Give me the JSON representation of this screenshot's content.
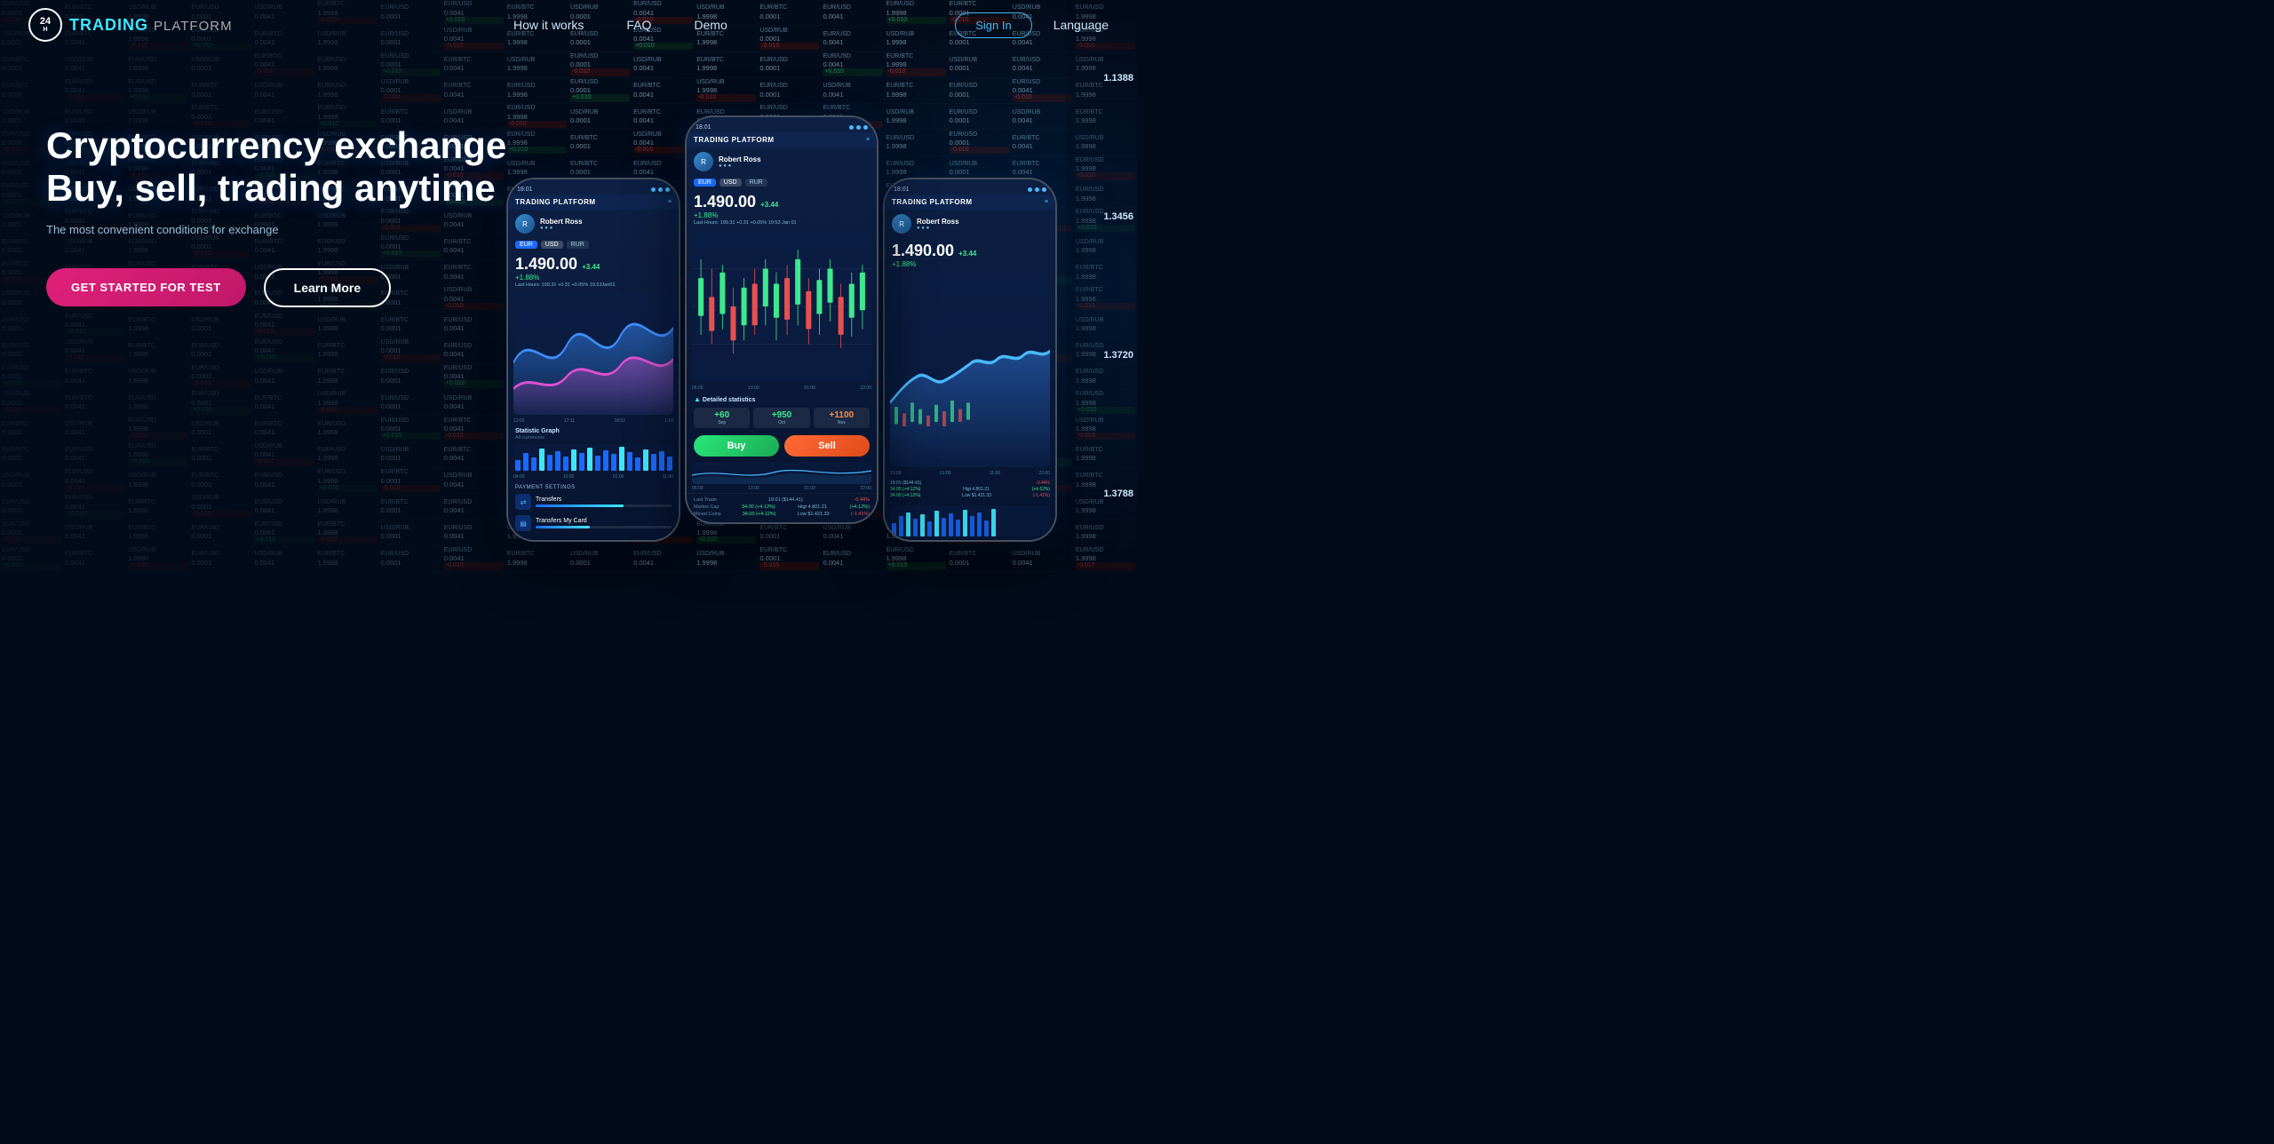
{
  "site": {
    "logo_24h": "24h",
    "logo_trading": "TRADING",
    "logo_platform": "PLATFORM",
    "nav_how": "How it works",
    "nav_faq": "FAQ",
    "nav_demo": "Demo",
    "btn_signin": "Sign In",
    "btn_language": "Language",
    "hero_line1": "Cryptocurrency exchange",
    "hero_line2": "Buy, sell, trading  anytime",
    "hero_sub": "The most convenient conditions for exchange",
    "btn_get_started": "GET STARTED FOR TEST",
    "btn_learn_more": "Learn More"
  },
  "phones": {
    "left": {
      "time": "18:01",
      "app_title": "TRADING PLATFORM",
      "user_name": "Robert Ross",
      "currency_tabs": [
        "EUR",
        "USD",
        "RUR"
      ],
      "price": "1.490.00",
      "change_pos": "+3.44",
      "change_pct": "+1.88%",
      "last_hours": "Last Hours: 199.31 +0.31 +0.05% 19.53Jan01",
      "section_statistic": "Statistic Graph",
      "section_all": "All currencies",
      "chart_times": [
        "12:02",
        "17:11",
        "18:02",
        "1:16"
      ],
      "payment_title": "PAYMENT SETTINGS",
      "payment_item1": "Transfers",
      "payment_item2": "Transfers My Card",
      "payment_fill1": "65%",
      "payment_fill2": "40%"
    },
    "center": {
      "time": "18:01",
      "app_title": "TRADING PLATFORM",
      "user_name": "Robert Ross",
      "currency_tabs": [
        "EUR",
        "USD",
        "RUR"
      ],
      "price": "1.490.00",
      "change_pos": "+3.44",
      "change_pct": "+1.88%",
      "last_hours": "Last Hours: 199.31 +0.31 +0.05% 19:53 Jan 01",
      "section_detailed": "Detailed statistics",
      "stat1_val": "+60",
      "stat1_lbl": "Sep",
      "stat2_val": "+950",
      "stat2_lbl": "Oct",
      "stat3_val": "+1100",
      "stat3_lbl": "Nov",
      "btn_buy": "Buy",
      "btn_sell": "Sell",
      "chart_times": [
        "06:00",
        "13:00",
        "01:00",
        "22:00"
      ],
      "trade_last": "Last Trade",
      "trade_last_val": "19:01 ($144.41)",
      "trade_last_chg": "-0.44%",
      "market_cap": "Market Cap",
      "market_cap_val": "34.00 (+4.12%)",
      "market_cap_higt": "Higt 4.801.21",
      "market_cap_higt_chg": "(+4.12%)",
      "mined": "Mined Coins",
      "mined_val": "34.00 (+4.12%)",
      "low": "Low $1.421.33",
      "low_chg": "(-1.41%)"
    },
    "right": {
      "time": "18:01",
      "app_title": "TRADING PLATFORM",
      "user_name": "Robert Ross",
      "price": "1.490.00",
      "change_pos": "+3.44",
      "change_pct": "+1.88%",
      "chart_times": [
        "13:00",
        "01:00",
        "11:00",
        "22:00"
      ],
      "bottom_label1": "19:01 ($144.41)",
      "bottom_chg1": "-0.44%",
      "bottom_row2a": "34.00 (+4.12%)",
      "bottom_row2b": "Higt 4.801.21",
      "bottom_row2c": "(+4.12%)",
      "bottom_row3a": "34.00 (+4.12%)",
      "bottom_row3b": "Low $1.421.33",
      "bottom_row3c": "(-1.41%)"
    }
  },
  "ticker_right": {
    "values": [
      "1.1388",
      "1.3456",
      "1.3720",
      "1.3788"
    ]
  }
}
